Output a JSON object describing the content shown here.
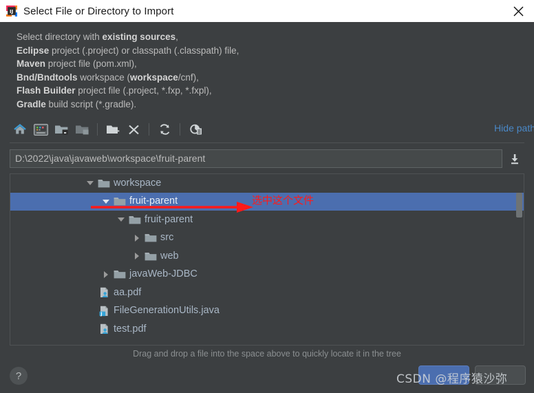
{
  "window": {
    "title": "Select File or Directory to Import",
    "logo_icon": "intellij-idea-logo",
    "close_icon": "close-icon"
  },
  "description": {
    "lines": [
      [
        {
          "t": "Select directory with ",
          "b": false
        },
        {
          "t": "existing sources",
          "b": true
        },
        {
          "t": ",",
          "b": false
        }
      ],
      [
        {
          "t": "Eclipse",
          "b": true
        },
        {
          "t": " project (.project) or classpath (.classpath) file,",
          "b": false
        }
      ],
      [
        {
          "t": "Maven",
          "b": true
        },
        {
          "t": " project file (pom.xml),",
          "b": false
        }
      ],
      [
        {
          "t": "Bnd/Bndtools",
          "b": true
        },
        {
          "t": " workspace (",
          "b": false
        },
        {
          "t": "workspace",
          "b": true
        },
        {
          "t": "/cnf),",
          "b": false
        }
      ],
      [
        {
          "t": "Flash Builder",
          "b": true
        },
        {
          "t": " project file (.project, *.fxp, *.fxpl),",
          "b": false
        }
      ],
      [
        {
          "t": "Gradle",
          "b": true
        },
        {
          "t": " build script (*.gradle).",
          "b": false
        }
      ]
    ]
  },
  "toolbar": {
    "buttons": [
      {
        "name": "home-icon",
        "tooltip": "Home"
      },
      {
        "name": "desktop-icon",
        "tooltip": "Desktop"
      },
      {
        "name": "project-folder-icon",
        "tooltip": "Project Directory"
      },
      {
        "name": "module-folder-icon",
        "tooltip": "Module Directory"
      },
      {
        "name": "new-folder-icon",
        "tooltip": "New Folder"
      },
      {
        "name": "delete-icon",
        "tooltip": "Delete"
      },
      {
        "name": "refresh-icon",
        "tooltip": "Refresh"
      },
      {
        "name": "show-hidden-files-icon",
        "tooltip": "Show Hidden Files and Directories"
      }
    ],
    "hide_path_label": "Hide path"
  },
  "path": {
    "value": "D:\\2022\\java\\javaweb\\workspace\\fruit-parent",
    "placeholder": "",
    "download_icon": "drop-down-download-icon"
  },
  "tree": {
    "rows": [
      {
        "label": "workspace",
        "indent": 108,
        "twisty": "down",
        "icon": "folder-icon",
        "selected": false
      },
      {
        "label": "fruit-parent",
        "indent": 131,
        "twisty": "down",
        "icon": "folder-icon",
        "selected": true
      },
      {
        "label": "fruit-parent",
        "indent": 153,
        "twisty": "down",
        "icon": "folder-icon",
        "selected": false
      },
      {
        "label": "src",
        "indent": 176,
        "twisty": "right",
        "icon": "folder-icon",
        "selected": false
      },
      {
        "label": "web",
        "indent": 176,
        "twisty": "right",
        "icon": "folder-icon",
        "selected": false
      },
      {
        "label": "javaWeb-JDBC",
        "indent": 131,
        "twisty": "right",
        "icon": "folder-icon",
        "selected": false
      },
      {
        "label": "aa.pdf",
        "indent": 108,
        "twisty": "none",
        "icon": "pdf-file-icon",
        "selected": false
      },
      {
        "label": "FileGenerationUtils.java",
        "indent": 108,
        "twisty": "none",
        "icon": "java-file-icon",
        "selected": false
      },
      {
        "label": "test.pdf",
        "indent": 108,
        "twisty": "none",
        "icon": "pdf-file-icon",
        "selected": false
      }
    ],
    "annotation_text": "选中这个文件",
    "annotation_color": "#ff1a1a"
  },
  "hint": {
    "text": "Drag and drop a file into the space above to quickly locate it in the tree"
  },
  "footer": {
    "help_label": "?",
    "ok_label": "",
    "cancel_label": "",
    "watermark": "CSDN @程序猿沙弥"
  },
  "colors": {
    "dialog_background": "#3c3f41",
    "titlebar_background": "#ffffff",
    "selection_blue": "#4b6eaf",
    "link_blue": "#4a88c7",
    "text_primary": "#bbbbbb",
    "tree_text": "#a9b7c6",
    "annotation_red": "#ff1a1a"
  }
}
